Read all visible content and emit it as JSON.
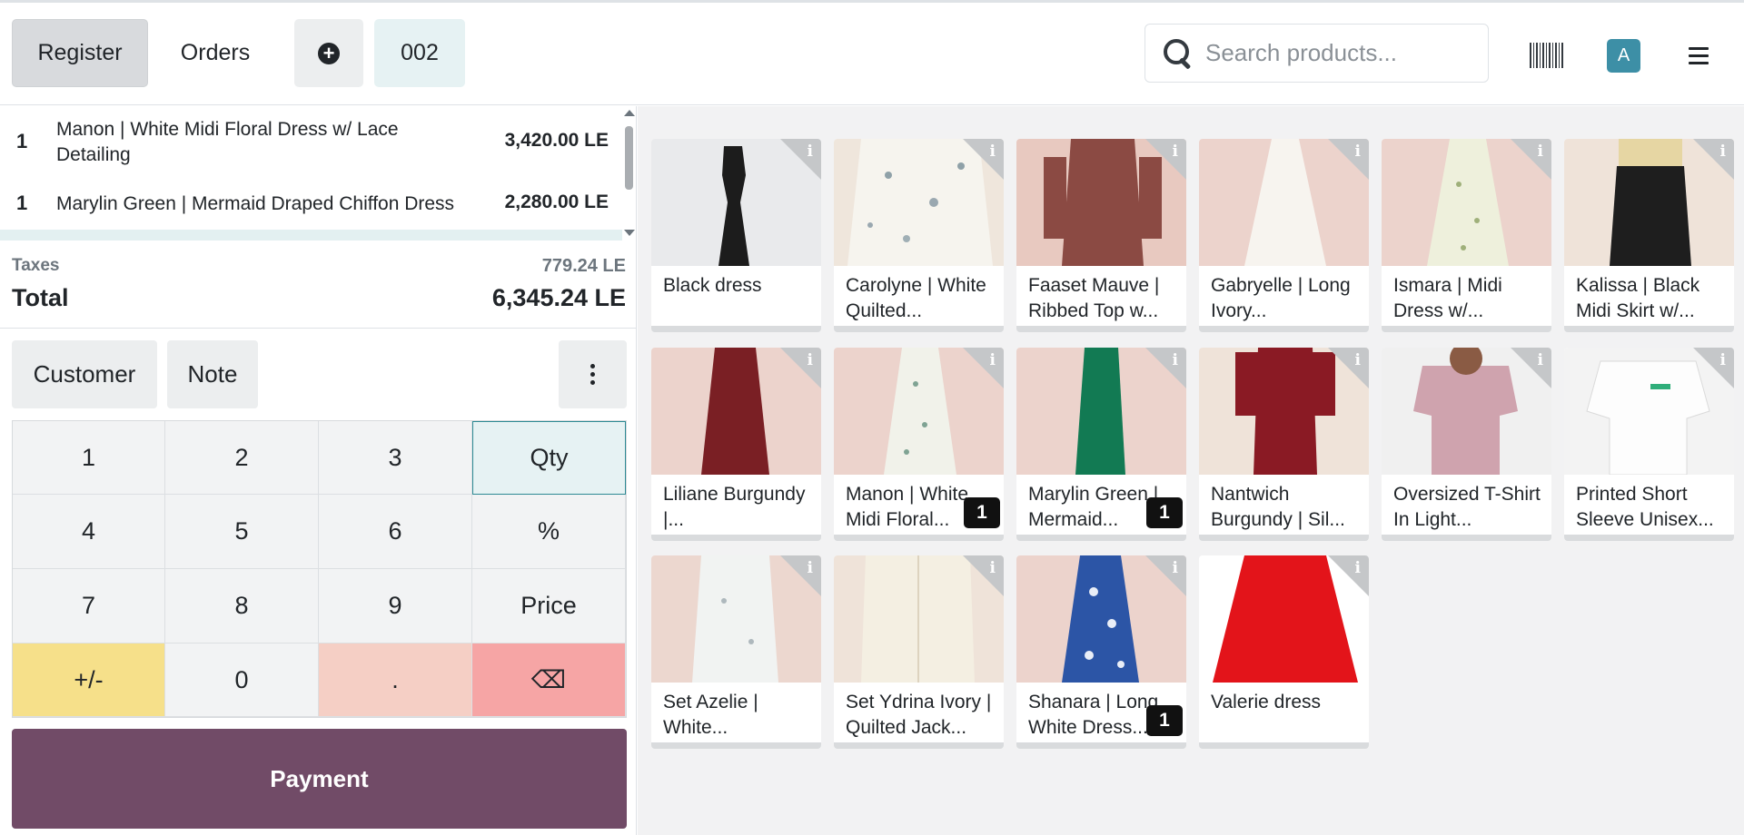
{
  "header": {
    "register_label": "Register",
    "orders_label": "Orders",
    "order_number": "002",
    "search_placeholder": "Search products...",
    "avatar_letter": "A"
  },
  "order": {
    "lines": [
      {
        "qty": "1",
        "name": "Manon | White Midi Floral Dress w/ Lace Detailing",
        "price": "3,420.00 LE"
      },
      {
        "qty": "1",
        "name": "Marylin Green | Mermaid Draped Chiffon Dress",
        "price": "2,280.00 LE"
      }
    ],
    "taxes_label": "Taxes",
    "taxes_value": "779.24 LE",
    "total_label": "Total",
    "total_value": "6,345.24 LE"
  },
  "controls": {
    "customer_label": "Customer",
    "note_label": "Note"
  },
  "numpad": {
    "keys": [
      "1",
      "2",
      "3",
      "Qty",
      "4",
      "5",
      "6",
      "%",
      "7",
      "8",
      "9",
      "Price",
      "+/-",
      "0",
      ".",
      "⌫"
    ]
  },
  "payment_label": "Payment",
  "products": [
    {
      "name": "Black dress",
      "badge": ""
    },
    {
      "name": "Carolyne | White Quilted...",
      "badge": ""
    },
    {
      "name": "Faaset Mauve | Ribbed Top w...",
      "badge": ""
    },
    {
      "name": "Gabryelle | Long Ivory...",
      "badge": ""
    },
    {
      "name": "Ismara | Midi Dress w/...",
      "badge": ""
    },
    {
      "name": "Kalissa | Black Midi Skirt w/...",
      "badge": ""
    },
    {
      "name": "Liliane Burgundy |...",
      "badge": ""
    },
    {
      "name": "Manon | White Midi Floral...",
      "badge": "1"
    },
    {
      "name": "Marylin Green | Mermaid...",
      "badge": "1"
    },
    {
      "name": "Nantwich Burgundy | Sil...",
      "badge": ""
    },
    {
      "name": "Oversized T-Shirt In Light...",
      "badge": ""
    },
    {
      "name": "Printed Short Sleeve Unisex...",
      "badge": ""
    },
    {
      "name": "Set Azelie | White...",
      "badge": ""
    },
    {
      "name": "Set Ydrina Ivory | Quilted Jack...",
      "badge": ""
    },
    {
      "name": "Shanara | Long White Dress...",
      "badge": "1"
    },
    {
      "name": "Valerie dress",
      "badge": ""
    }
  ],
  "colors": {
    "accent": "#714b67",
    "qty_key": "#e6f2f3",
    "sign_key": "#f6e08a",
    "dot_key": "#f5cfc5",
    "backspace_key": "#f6a5a5",
    "avatar": "#3d8fa6"
  }
}
